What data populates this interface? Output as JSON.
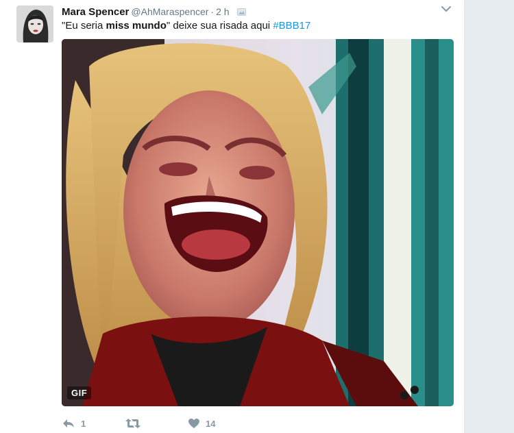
{
  "tweet": {
    "author_name": "Mara Spencer",
    "author_handle": "@AhMaraspencer",
    "separator": "·",
    "time": "2 h",
    "text_open": "\"Eu seria ",
    "text_bold": "miss mundo",
    "text_close": "\" deixe sua risada aqui ",
    "hashtag": "#BBB17"
  },
  "media": {
    "badge": "GIF"
  },
  "actions": {
    "reply_count": "1",
    "retweet_count": "",
    "like_count": "14"
  },
  "colors": {
    "hashtag": "#1b95e0",
    "action_icon": "#8899a6",
    "page_bg": "#e6ecf0"
  },
  "icons": [
    "caret-down-icon",
    "reply-icon",
    "retweet-icon",
    "heart-icon",
    "media-badge-icon"
  ]
}
